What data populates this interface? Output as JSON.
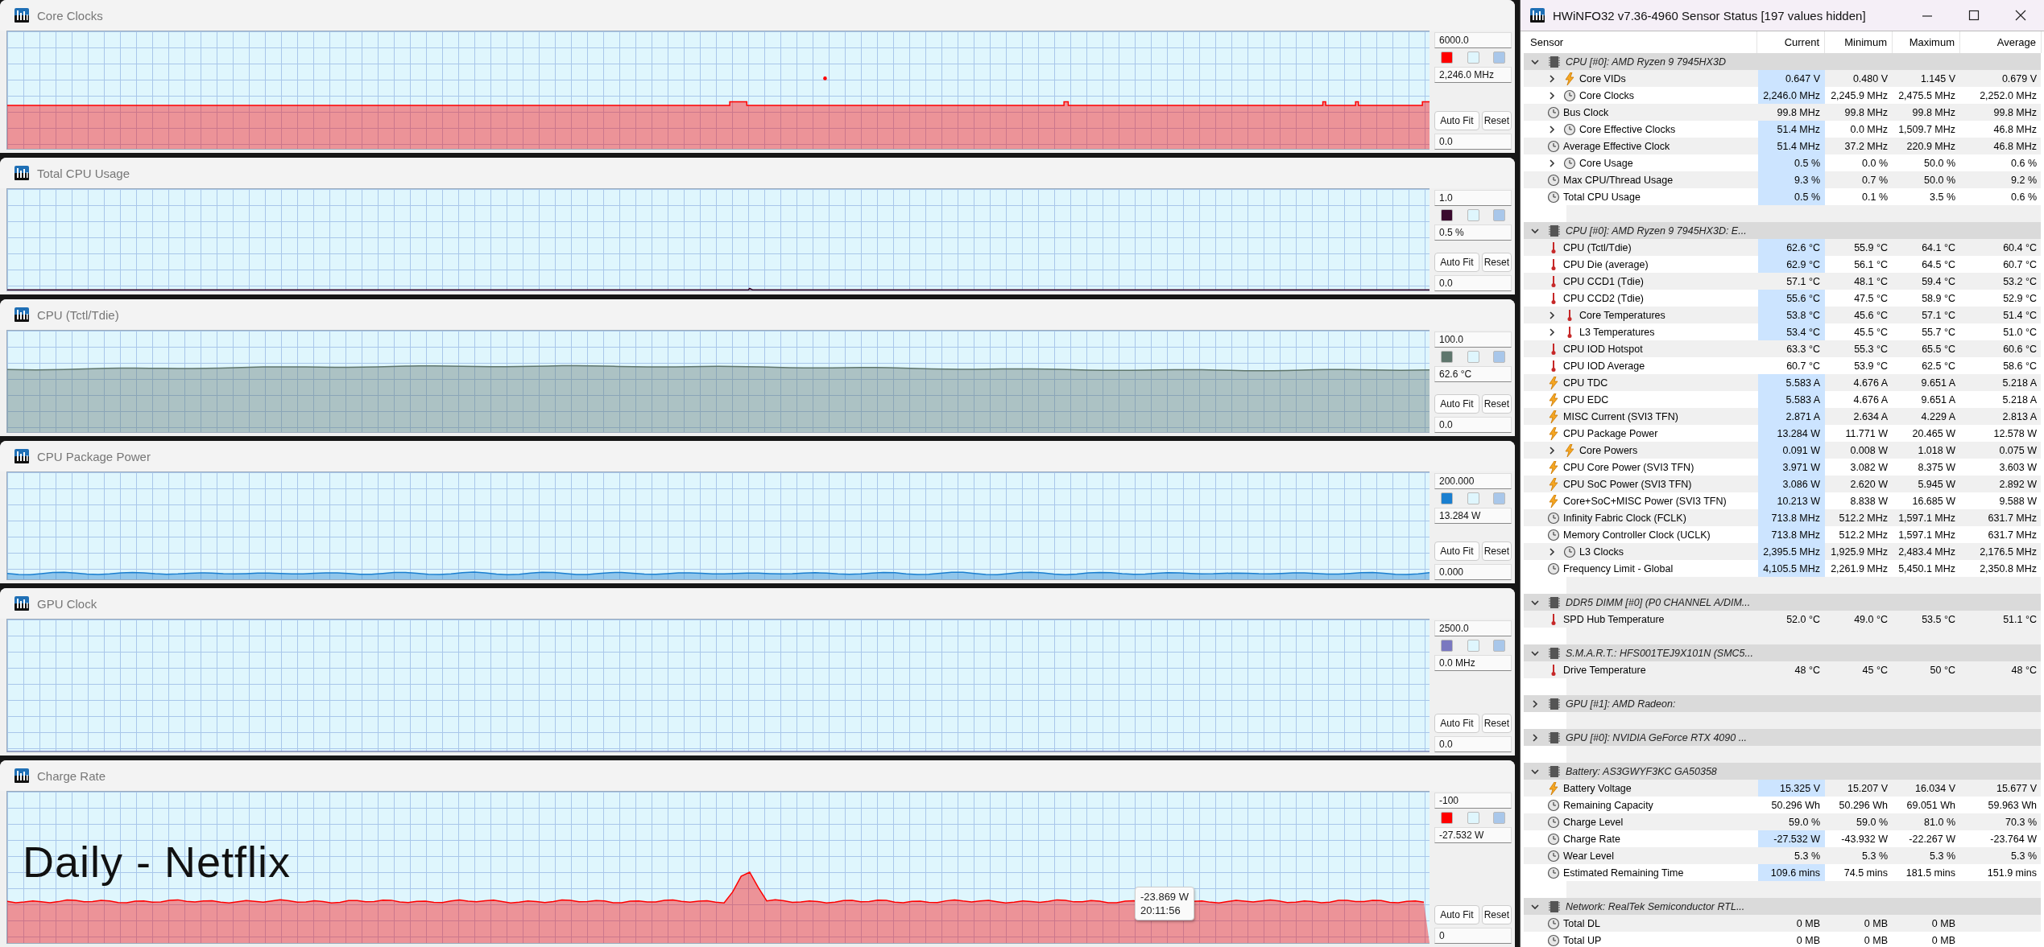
{
  "graphs": [
    {
      "title": "Core Clocks",
      "kind": "clock",
      "max": "6000.0",
      "current": "2,246.0 MHz",
      "min": "0.0",
      "swatches": [
        {
          "color": "#ff0000"
        },
        {
          "color": "#dff6fd"
        },
        {
          "color": "#a9c7ea"
        }
      ],
      "buttons": [
        "Auto Fit",
        "Reset"
      ]
    },
    {
      "title": "Total CPU Usage",
      "kind": "usage",
      "max": "1.0",
      "current": "0.5 %",
      "min": "0.0",
      "swatches": [
        {
          "color": "#3a0a2e"
        },
        {
          "color": "#dff6fd"
        },
        {
          "color": "#a9c7ea"
        }
      ],
      "buttons": [
        "Auto Fit",
        "Reset"
      ]
    },
    {
      "title": "CPU (Tctl/Tdie)",
      "kind": "temperature",
      "max": "100.0",
      "current": "62.6 °C",
      "min": "0.0",
      "swatches": [
        {
          "color": "#5f766d"
        },
        {
          "color": "#dff6fd"
        },
        {
          "color": "#a9c7ea"
        }
      ],
      "buttons": [
        "Auto Fit",
        "Reset"
      ]
    },
    {
      "title": "CPU Package Power",
      "kind": "power",
      "max": "200.000",
      "current": "13.284 W",
      "min": "0.000",
      "swatches": [
        {
          "color": "#1a7fd0"
        },
        {
          "color": "#dff6fd"
        },
        {
          "color": "#a9c7ea"
        }
      ],
      "buttons": [
        "Auto Fit",
        "Reset"
      ]
    },
    {
      "title": "GPU Clock",
      "kind": "gpu",
      "max": "2500.0",
      "current": "0.0 MHz",
      "min": "0.0",
      "swatches": [
        {
          "color": "#7a78c0"
        },
        {
          "color": "#dff6fd"
        },
        {
          "color": "#a9c7ea"
        }
      ],
      "buttons": [
        "Auto Fit",
        "Reset"
      ]
    },
    {
      "title": "Charge Rate",
      "kind": "charge",
      "max": "-100",
      "current": "-27.532 W",
      "min": "0",
      "swatches": [
        {
          "color": "#ff0000"
        },
        {
          "color": "#dff6fd"
        },
        {
          "color": "#a9c7ea"
        }
      ],
      "buttons": [
        "Auto Fit",
        "Reset"
      ],
      "tooltip": {
        "value": "-23.869 W",
        "time": "20:11:56"
      }
    }
  ],
  "caption": "Daily - Netflix",
  "sensor_window": {
    "title": "HWiNFO32 v7.36-4960 Sensor Status [197 values hidden]",
    "columns": [
      "Sensor",
      "Current",
      "Minimum",
      "Maximum",
      "Average"
    ],
    "groups": [
      {
        "name": "CPU [#0]: AMD Ryzen 9 7945HX3D",
        "expanded": true,
        "sensors": [
          {
            "name": "Core VIDs",
            "kind": "bolt",
            "has_children": true,
            "highlighted": true,
            "current": "0.647 V",
            "minimum": "0.480 V",
            "maximum": "1.145 V",
            "average": "0.679 V"
          },
          {
            "name": "Core Clocks",
            "kind": "clock",
            "has_children": true,
            "highlighted": true,
            "current": "2,246.0 MHz",
            "minimum": "2,245.9 MHz",
            "maximum": "2,475.5 MHz",
            "average": "2,252.0 MHz"
          },
          {
            "name": "Bus Clock",
            "kind": "clock",
            "has_children": false,
            "highlighted": false,
            "current": "99.8 MHz",
            "minimum": "99.8 MHz",
            "maximum": "99.8 MHz",
            "average": "99.8 MHz"
          },
          {
            "name": "Core Effective Clocks",
            "kind": "clock",
            "has_children": true,
            "highlighted": true,
            "current": "51.4 MHz",
            "minimum": "0.0 MHz",
            "maximum": "1,509.7 MHz",
            "average": "46.8 MHz"
          },
          {
            "name": "Average Effective Clock",
            "kind": "clock",
            "has_children": false,
            "highlighted": true,
            "current": "51.4 MHz",
            "minimum": "37.2 MHz",
            "maximum": "220.9 MHz",
            "average": "46.8 MHz"
          },
          {
            "name": "Core Usage",
            "kind": "clock",
            "has_children": true,
            "highlighted": true,
            "current": "0.5 %",
            "minimum": "0.0 %",
            "maximum": "50.0 %",
            "average": "0.6 %"
          },
          {
            "name": "Max CPU/Thread Usage",
            "kind": "clock",
            "has_children": false,
            "highlighted": true,
            "current": "9.3 %",
            "minimum": "0.7 %",
            "maximum": "50.0 %",
            "average": "9.2 %"
          },
          {
            "name": "Total CPU Usage",
            "kind": "clock",
            "has_children": false,
            "highlighted": true,
            "current": "0.5 %",
            "minimum": "0.1 %",
            "maximum": "3.5 %",
            "average": "0.6 %"
          }
        ]
      },
      {
        "name": "CPU [#0]: AMD Ryzen 9 7945HX3D: E...",
        "expanded": true,
        "sensors": [
          {
            "name": "CPU (Tctl/Tdie)",
            "kind": "thermo",
            "has_children": false,
            "highlighted": true,
            "current": "62.6 °C",
            "minimum": "55.9 °C",
            "maximum": "64.1 °C",
            "average": "60.4 °C"
          },
          {
            "name": "CPU Die (average)",
            "kind": "thermo",
            "has_children": false,
            "highlighted": true,
            "current": "62.9 °C",
            "minimum": "56.1 °C",
            "maximum": "64.5 °C",
            "average": "60.7 °C"
          },
          {
            "name": "CPU CCD1 (Tdie)",
            "kind": "thermo",
            "has_children": false,
            "highlighted": false,
            "current": "57.1 °C",
            "minimum": "48.1 °C",
            "maximum": "59.4 °C",
            "average": "53.2 °C"
          },
          {
            "name": "CPU CCD2 (Tdie)",
            "kind": "thermo",
            "has_children": false,
            "highlighted": true,
            "current": "55.6 °C",
            "minimum": "47.5 °C",
            "maximum": "58.9 °C",
            "average": "52.9 °C"
          },
          {
            "name": "Core Temperatures",
            "kind": "thermo",
            "has_children": true,
            "highlighted": true,
            "current": "53.8 °C",
            "minimum": "45.6 °C",
            "maximum": "57.1 °C",
            "average": "51.4 °C"
          },
          {
            "name": "L3 Temperatures",
            "kind": "thermo",
            "has_children": true,
            "highlighted": true,
            "current": "53.4 °C",
            "minimum": "45.5 °C",
            "maximum": "55.7 °C",
            "average": "51.0 °C"
          },
          {
            "name": "CPU IOD Hotspot",
            "kind": "thermo",
            "has_children": false,
            "highlighted": false,
            "current": "63.3 °C",
            "minimum": "55.3 °C",
            "maximum": "65.5 °C",
            "average": "60.6 °C"
          },
          {
            "name": "CPU IOD Average",
            "kind": "thermo",
            "has_children": false,
            "highlighted": false,
            "current": "60.7 °C",
            "minimum": "53.9 °C",
            "maximum": "62.5 °C",
            "average": "58.6 °C"
          },
          {
            "name": "CPU TDC",
            "kind": "bolt",
            "has_children": false,
            "highlighted": true,
            "current": "5.583 A",
            "minimum": "4.676 A",
            "maximum": "9.651 A",
            "average": "5.218 A"
          },
          {
            "name": "CPU EDC",
            "kind": "bolt",
            "has_children": false,
            "highlighted": true,
            "current": "5.583 A",
            "minimum": "4.676 A",
            "maximum": "9.651 A",
            "average": "5.218 A"
          },
          {
            "name": "MISC Current (SVI3 TFN)",
            "kind": "bolt",
            "has_children": false,
            "highlighted": true,
            "current": "2.871 A",
            "minimum": "2.634 A",
            "maximum": "4.229 A",
            "average": "2.813 A"
          },
          {
            "name": "CPU Package Power",
            "kind": "bolt",
            "has_children": false,
            "highlighted": true,
            "current": "13.284 W",
            "minimum": "11.771 W",
            "maximum": "20.465 W",
            "average": "12.578 W"
          },
          {
            "name": "Core Powers",
            "kind": "bolt",
            "has_children": true,
            "highlighted": true,
            "current": "0.091 W",
            "minimum": "0.008 W",
            "maximum": "1.018 W",
            "average": "0.075 W"
          },
          {
            "name": "CPU Core Power (SVI3 TFN)",
            "kind": "bolt",
            "has_children": false,
            "highlighted": true,
            "current": "3.971 W",
            "minimum": "3.082 W",
            "maximum": "8.375 W",
            "average": "3.603 W"
          },
          {
            "name": "CPU SoC Power (SVI3 TFN)",
            "kind": "bolt",
            "has_children": false,
            "highlighted": true,
            "current": "3.086 W",
            "minimum": "2.620 W",
            "maximum": "5.945 W",
            "average": "2.892 W"
          },
          {
            "name": "Core+SoC+MISC Power (SVI3 TFN)",
            "kind": "bolt",
            "has_children": false,
            "highlighted": true,
            "current": "10.213 W",
            "minimum": "8.838 W",
            "maximum": "16.685 W",
            "average": "9.588 W"
          },
          {
            "name": "Infinity Fabric Clock (FCLK)",
            "kind": "clock",
            "has_children": false,
            "highlighted": true,
            "current": "713.8 MHz",
            "minimum": "512.2 MHz",
            "maximum": "1,597.1 MHz",
            "average": "631.7 MHz"
          },
          {
            "name": "Memory Controller Clock (UCLK)",
            "kind": "clock",
            "has_children": false,
            "highlighted": true,
            "current": "713.8 MHz",
            "minimum": "512.2 MHz",
            "maximum": "1,597.1 MHz",
            "average": "631.7 MHz"
          },
          {
            "name": "L3 Clocks",
            "kind": "clock",
            "has_children": true,
            "highlighted": true,
            "current": "2,395.5 MHz",
            "minimum": "1,925.9 MHz",
            "maximum": "2,483.4 MHz",
            "average": "2,176.5 MHz"
          },
          {
            "name": "Frequency Limit - Global",
            "kind": "clock",
            "has_children": false,
            "highlighted": true,
            "current": "4,105.5 MHz",
            "minimum": "2,261.9 MHz",
            "maximum": "5,450.1 MHz",
            "average": "2,350.8 MHz"
          }
        ]
      },
      {
        "name": "DDR5 DIMM [#0] (P0 CHANNEL A/DIM...",
        "expanded": true,
        "sensors": [
          {
            "name": "SPD Hub Temperature",
            "kind": "thermo",
            "has_children": false,
            "highlighted": false,
            "current": "52.0 °C",
            "minimum": "49.0 °C",
            "maximum": "53.5 °C",
            "average": "51.1 °C"
          }
        ]
      },
      {
        "name": "S.M.A.R.T.: HFS001TEJ9X101N (SMC5...",
        "expanded": true,
        "sensors": [
          {
            "name": "Drive Temperature",
            "kind": "thermo",
            "has_children": false,
            "highlighted": false,
            "current": "48 °C",
            "minimum": "45 °C",
            "maximum": "50 °C",
            "average": "48 °C"
          }
        ]
      },
      {
        "name": "GPU [#1]: AMD Radeon:",
        "expanded": false
      },
      {
        "name": "GPU [#0]: NVIDIA GeForce RTX 4090 ...",
        "expanded": false
      },
      {
        "name": "Battery: AS3GWYF3KC GA50358",
        "expanded": true,
        "sensors": [
          {
            "name": "Battery Voltage",
            "kind": "bolt",
            "has_children": false,
            "highlighted": true,
            "current": "15.325 V",
            "minimum": "15.207 V",
            "maximum": "16.034 V",
            "average": "15.677 V"
          },
          {
            "name": "Remaining Capacity",
            "kind": "clock",
            "has_children": false,
            "highlighted": false,
            "current": "50.296 Wh",
            "minimum": "50.296 Wh",
            "maximum": "69.051 Wh",
            "average": "59.963 Wh"
          },
          {
            "name": "Charge Level",
            "kind": "clock",
            "has_children": false,
            "highlighted": false,
            "current": "59.0 %",
            "minimum": "59.0 %",
            "maximum": "81.0 %",
            "average": "70.3 %"
          },
          {
            "name": "Charge Rate",
            "kind": "clock",
            "has_children": false,
            "highlighted": true,
            "current": "-27.532 W",
            "minimum": "-43.932 W",
            "maximum": "-22.267 W",
            "average": "-23.764 W"
          },
          {
            "name": "Wear Level",
            "kind": "clock",
            "has_children": false,
            "highlighted": false,
            "current": "5.3 %",
            "minimum": "5.3 %",
            "maximum": "5.3 %",
            "average": "5.3 %"
          },
          {
            "name": "Estimated Remaining Time",
            "kind": "clock",
            "has_children": false,
            "highlighted": true,
            "current": "109.6 mins",
            "minimum": "74.5 mins",
            "maximum": "181.5 mins",
            "average": "151.9 mins"
          }
        ]
      },
      {
        "name": "Network: RealTek Semiconductor RTL...",
        "expanded": true,
        "sensors": [
          {
            "name": "Total DL",
            "kind": "clock",
            "has_children": false,
            "highlighted": false,
            "current": "0 MB",
            "minimum": "0 MB",
            "maximum": "0 MB"
          },
          {
            "name": "Total UP",
            "kind": "clock",
            "has_children": false,
            "highlighted": false,
            "current": "0 MB",
            "minimum": "0 MB",
            "maximum": "0 MB"
          }
        ]
      }
    ]
  }
}
